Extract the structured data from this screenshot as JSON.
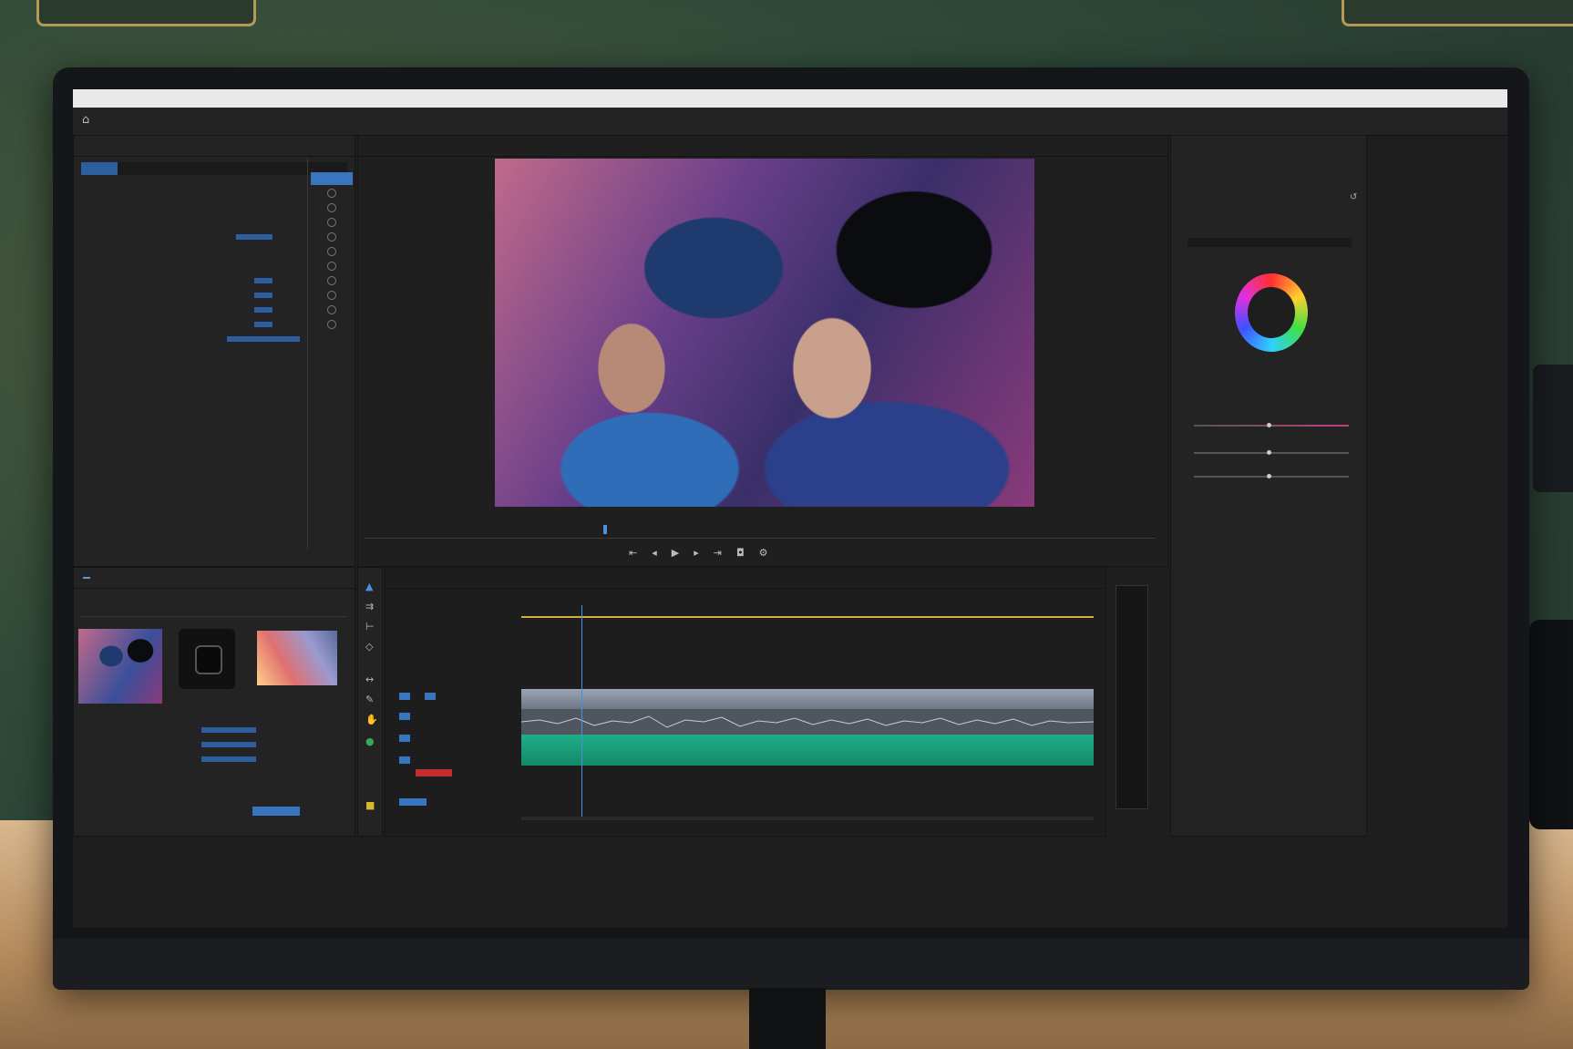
{
  "app": {
    "title_bar_text": "",
    "workspaces": [
      "",
      "",
      "",
      "",
      "",
      "",
      "",
      ""
    ]
  },
  "effect_controls": {
    "tabs": [
      "",
      "",
      "",
      ""
    ],
    "rows": [
      "",
      "",
      "",
      "",
      "",
      "",
      "",
      "",
      "",
      "",
      "",
      "",
      "",
      "",
      ""
    ]
  },
  "program_monitor": {
    "tabs": [
      "",
      "",
      "",
      ""
    ],
    "timecode_left": "",
    "timecode_right": ""
  },
  "project": {
    "tabs": [
      "",
      "",
      "",
      "",
      ""
    ],
    "items": [
      {
        "name": "",
        "duration": ""
      },
      {
        "name": "",
        "duration": ""
      },
      {
        "name": "",
        "duration": ""
      }
    ]
  },
  "timeline": {
    "tab": "",
    "timecode": "",
    "ruler_ticks": [
      "",
      "",
      "",
      "",
      "",
      "",
      "",
      "",
      "",
      ""
    ]
  },
  "lumetri": {
    "sections": [
      "",
      "",
      "",
      "",
      "",
      "",
      "",
      "",
      "",
      "",
      "",
      "",
      "",
      "",
      ""
    ]
  },
  "colors": {
    "accent_blue": "#5a9bd5",
    "audio_clip": "#1fae87",
    "video_clip": "#8a94a3",
    "panel_bg": "#232323"
  },
  "icons": {
    "home": "home-icon",
    "transport": [
      "go-to-in-icon",
      "step-back-icon",
      "play-icon",
      "step-forward-icon",
      "go-to-out-icon",
      "camera-icon",
      "settings-icon"
    ],
    "tools": [
      "selection-tool-icon",
      "track-select-icon",
      "ripple-edit-icon",
      "razor-icon",
      "slip-icon",
      "pen-icon",
      "hand-icon",
      "type-icon"
    ]
  }
}
